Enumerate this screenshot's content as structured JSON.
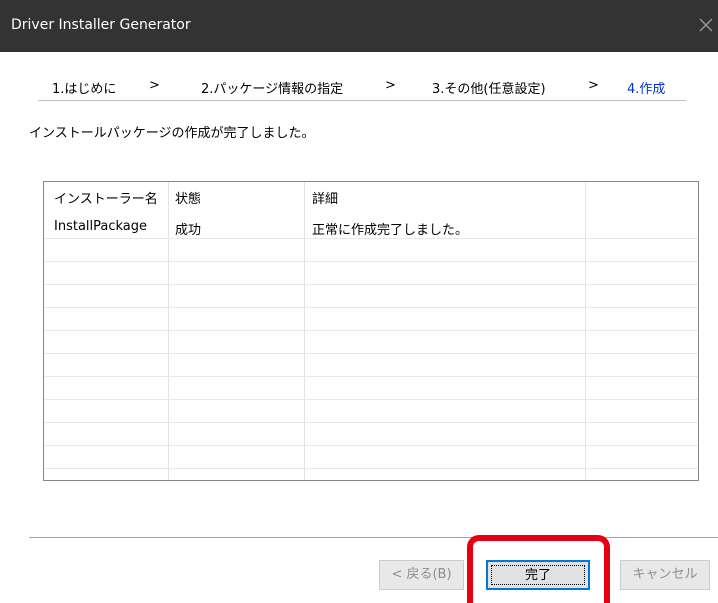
{
  "window": {
    "title": "Driver Installer Generator"
  },
  "steps": [
    {
      "label": "1.はじめに",
      "active": false
    },
    {
      "label": ">",
      "active": false
    },
    {
      "label": "2.パッケージ情報の指定",
      "active": false
    },
    {
      "label": ">",
      "active": false
    },
    {
      "label": "3.その他(任意設定)",
      "active": false
    },
    {
      "label": ">",
      "active": false
    },
    {
      "label": "4.作成",
      "active": true
    }
  ],
  "message": "インストールパッケージの作成が完了しました。",
  "table": {
    "headers": [
      "インストーラー名",
      "状態",
      "詳細"
    ],
    "rows": [
      [
        "InstallPackage",
        "成功",
        "正常に作成完了しました。"
      ]
    ]
  },
  "buttons": {
    "back": "< 戻る(B)",
    "finish": "完了",
    "cancel": "キャンセル"
  },
  "colors": {
    "titlebar": "#333333",
    "active_step": "#0033cc",
    "highlight": "#e60012",
    "focus": "#0078d7"
  }
}
